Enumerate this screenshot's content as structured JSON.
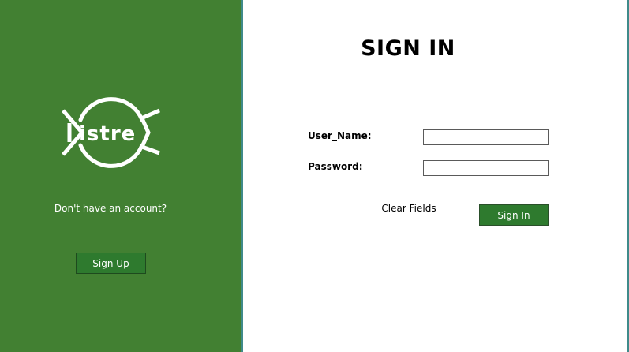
{
  "brand": {
    "logo_text": "DistreX",
    "logo_icon": "distrex-logo-icon"
  },
  "left_panel": {
    "prompt_text": "Don't have an account?",
    "signup_label": "Sign Up"
  },
  "form": {
    "title": "SIGN IN",
    "username_label": "User_Name:",
    "username_value": "",
    "password_label": "Password:",
    "password_value": "",
    "clear_label": "Clear Fields",
    "signin_label": "Sign In"
  },
  "colors": {
    "panel_green": "#428032",
    "button_green": "#2e7a2e",
    "divider_teal": "#3f8a8a"
  }
}
